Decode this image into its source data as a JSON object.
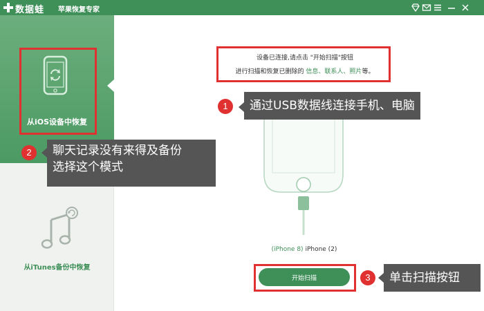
{
  "titlebar": {
    "app_name": "数据蛙",
    "subtitle": "苹果恢复专家",
    "icons": [
      "logo-plus-icon",
      "diamond-icon",
      "mail-icon",
      "menu-icon",
      "minimize-icon",
      "close-icon"
    ],
    "color": "#3e8f58"
  },
  "sidebar": {
    "modes": [
      {
        "label": "从iOS设备中恢复",
        "icon": "phone-refresh-icon",
        "active": true
      },
      {
        "label": "从iTunes备份中恢复",
        "icon": "music-note-icon",
        "active": false
      }
    ]
  },
  "main": {
    "instruction_line1": "设备已连接,请点击 \"开始扫描\"按钮",
    "instruction_line2_prefix": "进行扫描和恢复已删除的 ",
    "instruction_line2_links": "信息、联系人、照片",
    "instruction_line2_suffix": "等。",
    "device_model": "(iPhone 8)",
    "device_name": "iPhone (2)",
    "start_scan_label": "开始扫描"
  },
  "annotations": [
    {
      "number": "1",
      "text": "通过USB数据线连接手机、电脑"
    },
    {
      "number": "2",
      "text_line1": "聊天记录没有来得及备份",
      "text_line2": "选择这个模式"
    },
    {
      "number": "3",
      "text": "单击扫描按钮"
    }
  ],
  "colors": {
    "accent": "#3e8f58",
    "annotation_red": "#e03030",
    "callout_bg": "#555555"
  }
}
